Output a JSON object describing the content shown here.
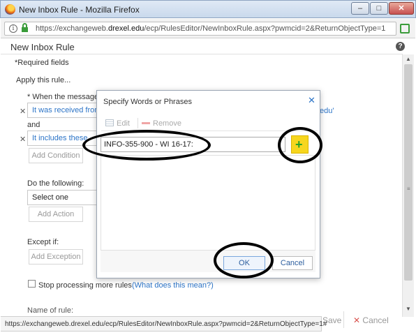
{
  "window": {
    "title": "New Inbox Rule - Mozilla Firefox",
    "min_glyph": "–",
    "max_glyph": "□",
    "close_glyph": "✕"
  },
  "browser": {
    "info_glyph": "i",
    "url_prefix": "https://exchangeweb.",
    "url_domain": "drexel.edu",
    "url_suffix": "/ecp/RulesEditor/NewInboxRule.aspx?pwmcid=2&ReturnObjectType=1"
  },
  "page": {
    "title": "New Inbox Rule",
    "required_note": "*Required fields",
    "apply_rule": "Apply this rule...",
    "when_label": "* When the message",
    "condition_1": "It was received from",
    "condition_1_tail": "edu'",
    "and_label": "and",
    "condition_2": "It includes these",
    "add_condition": "Add Condition",
    "do_following": "Do the following:",
    "action_select": "Select one",
    "add_action": "Add Action",
    "except_if": "Except if:",
    "add_exception": "Add Exception",
    "stop_processing": "Stop processing more rules",
    "what_does": "(What does this mean?)",
    "name_partial": "Name of rule:",
    "remove_glyph": "✕"
  },
  "footer": {
    "save": "Save",
    "cancel": "Cancel",
    "cancel_glyph": "✕"
  },
  "status_url": "https://exchangeweb.drexel.edu/ecp/RulesEditor/NewInboxRule.aspx?pwmcid=2&ReturnObjectType=1#",
  "dialog": {
    "title": "Specify Words or Phrases",
    "close_glyph": "✕",
    "toolbar": {
      "edit": "Edit",
      "remove": "Remove"
    },
    "phrase_value": "INFO-355-900 - WI 16-17:",
    "add_glyph": "+",
    "ok": "OK",
    "cancel": "Cancel"
  },
  "colors": {
    "link": "#2c74c7",
    "add_button": "#f7d61e",
    "annotation": "#000000"
  }
}
